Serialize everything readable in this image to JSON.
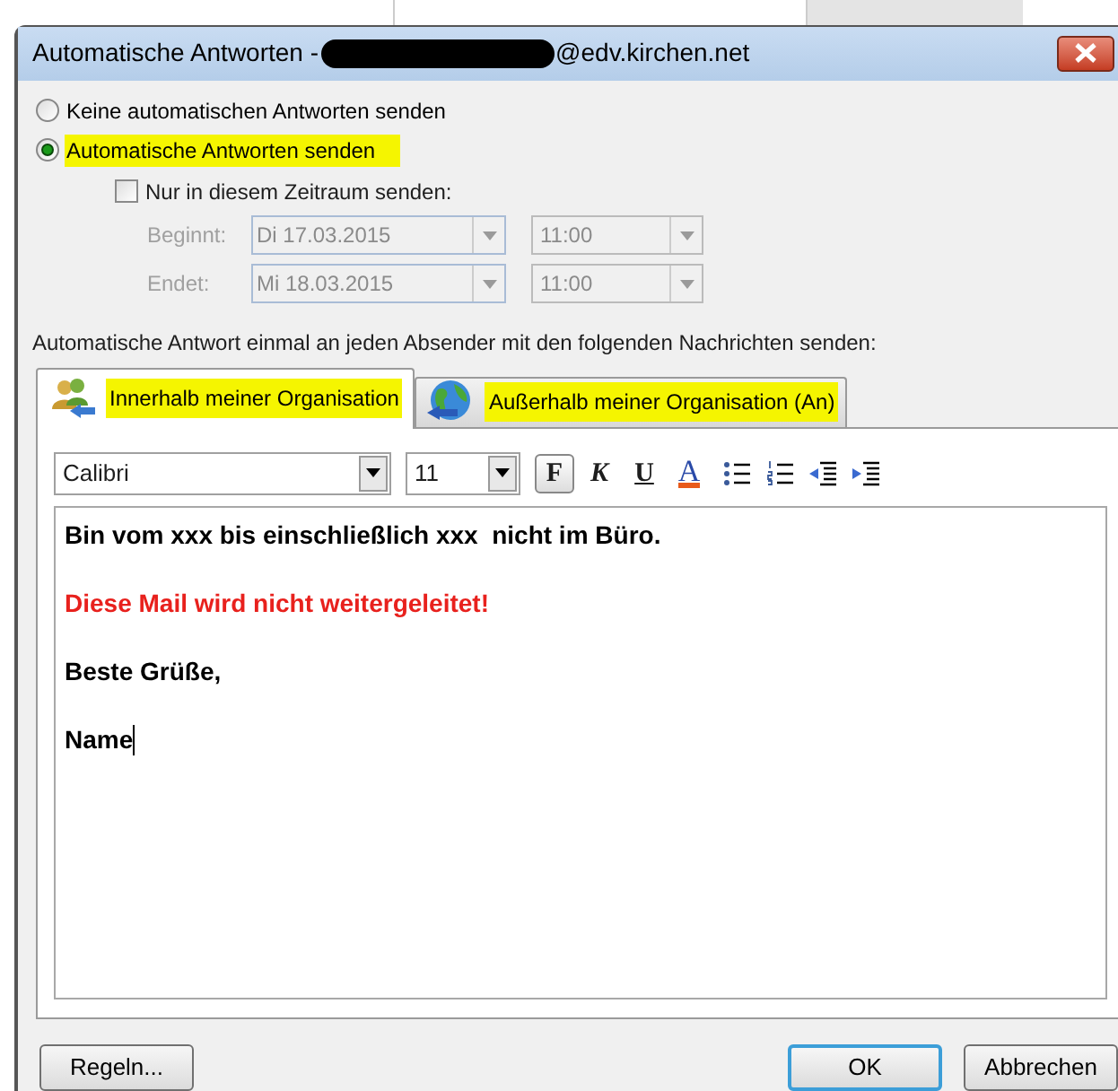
{
  "window": {
    "title": "Automatische Antworten -",
    "title_suffix": "@edv.kirchen.net"
  },
  "reply_options": [
    {
      "label": "Keine automatischen Antworten senden",
      "selected": false,
      "highlighted": false
    },
    {
      "label": "Automatische Antworten senden",
      "selected": true,
      "highlighted": true
    }
  ],
  "schedule": {
    "label": "Nur in diesem Zeitraum senden:",
    "checked": false,
    "rows": [
      {
        "label": "Beginnt:",
        "date": "Di 17.03.2015",
        "time": "11:00"
      },
      {
        "label": "Endet:",
        "date": "Mi 18.03.2015",
        "time": "11:00"
      }
    ]
  },
  "message_label": "Automatische Antwort einmal an jeden Absender mit den folgenden Nachrichten senden:",
  "tabs": [
    {
      "label": "Innerhalb meiner Organisation",
      "kind": "people",
      "selected": true,
      "highlighted": true
    },
    {
      "label": "Außerhalb meiner Organisation (An)",
      "kind": "globe",
      "selected": false,
      "highlighted": true
    }
  ],
  "toolbar": {
    "font": "Calibri",
    "size": "11",
    "format_buttons": [
      {
        "label": "F",
        "kind": "bold",
        "selected": true
      },
      {
        "label": "K",
        "kind": "italic",
        "selected": false
      },
      {
        "label": "U",
        "kind": "underline",
        "selected": false
      },
      {
        "label": "A",
        "kind": "color",
        "selected": false
      }
    ]
  },
  "message": {
    "lines": [
      {
        "text": "Bin vom xxx bis einschließlich xxx  nicht im Büro.",
        "color": "#000000"
      },
      {
        "text": "Diese Mail wird nicht weitergeleitet!",
        "color": "#e8211d"
      },
      {
        "text": "Beste Grüße,",
        "color": "#000000"
      },
      {
        "text": "Name",
        "color": "#000000"
      }
    ],
    "caret": true
  },
  "buttons": [
    {
      "label": "Regeln...",
      "default": false
    },
    {
      "label": "OK",
      "default": true
    },
    {
      "label": "Abbrechen",
      "default": false
    }
  ]
}
